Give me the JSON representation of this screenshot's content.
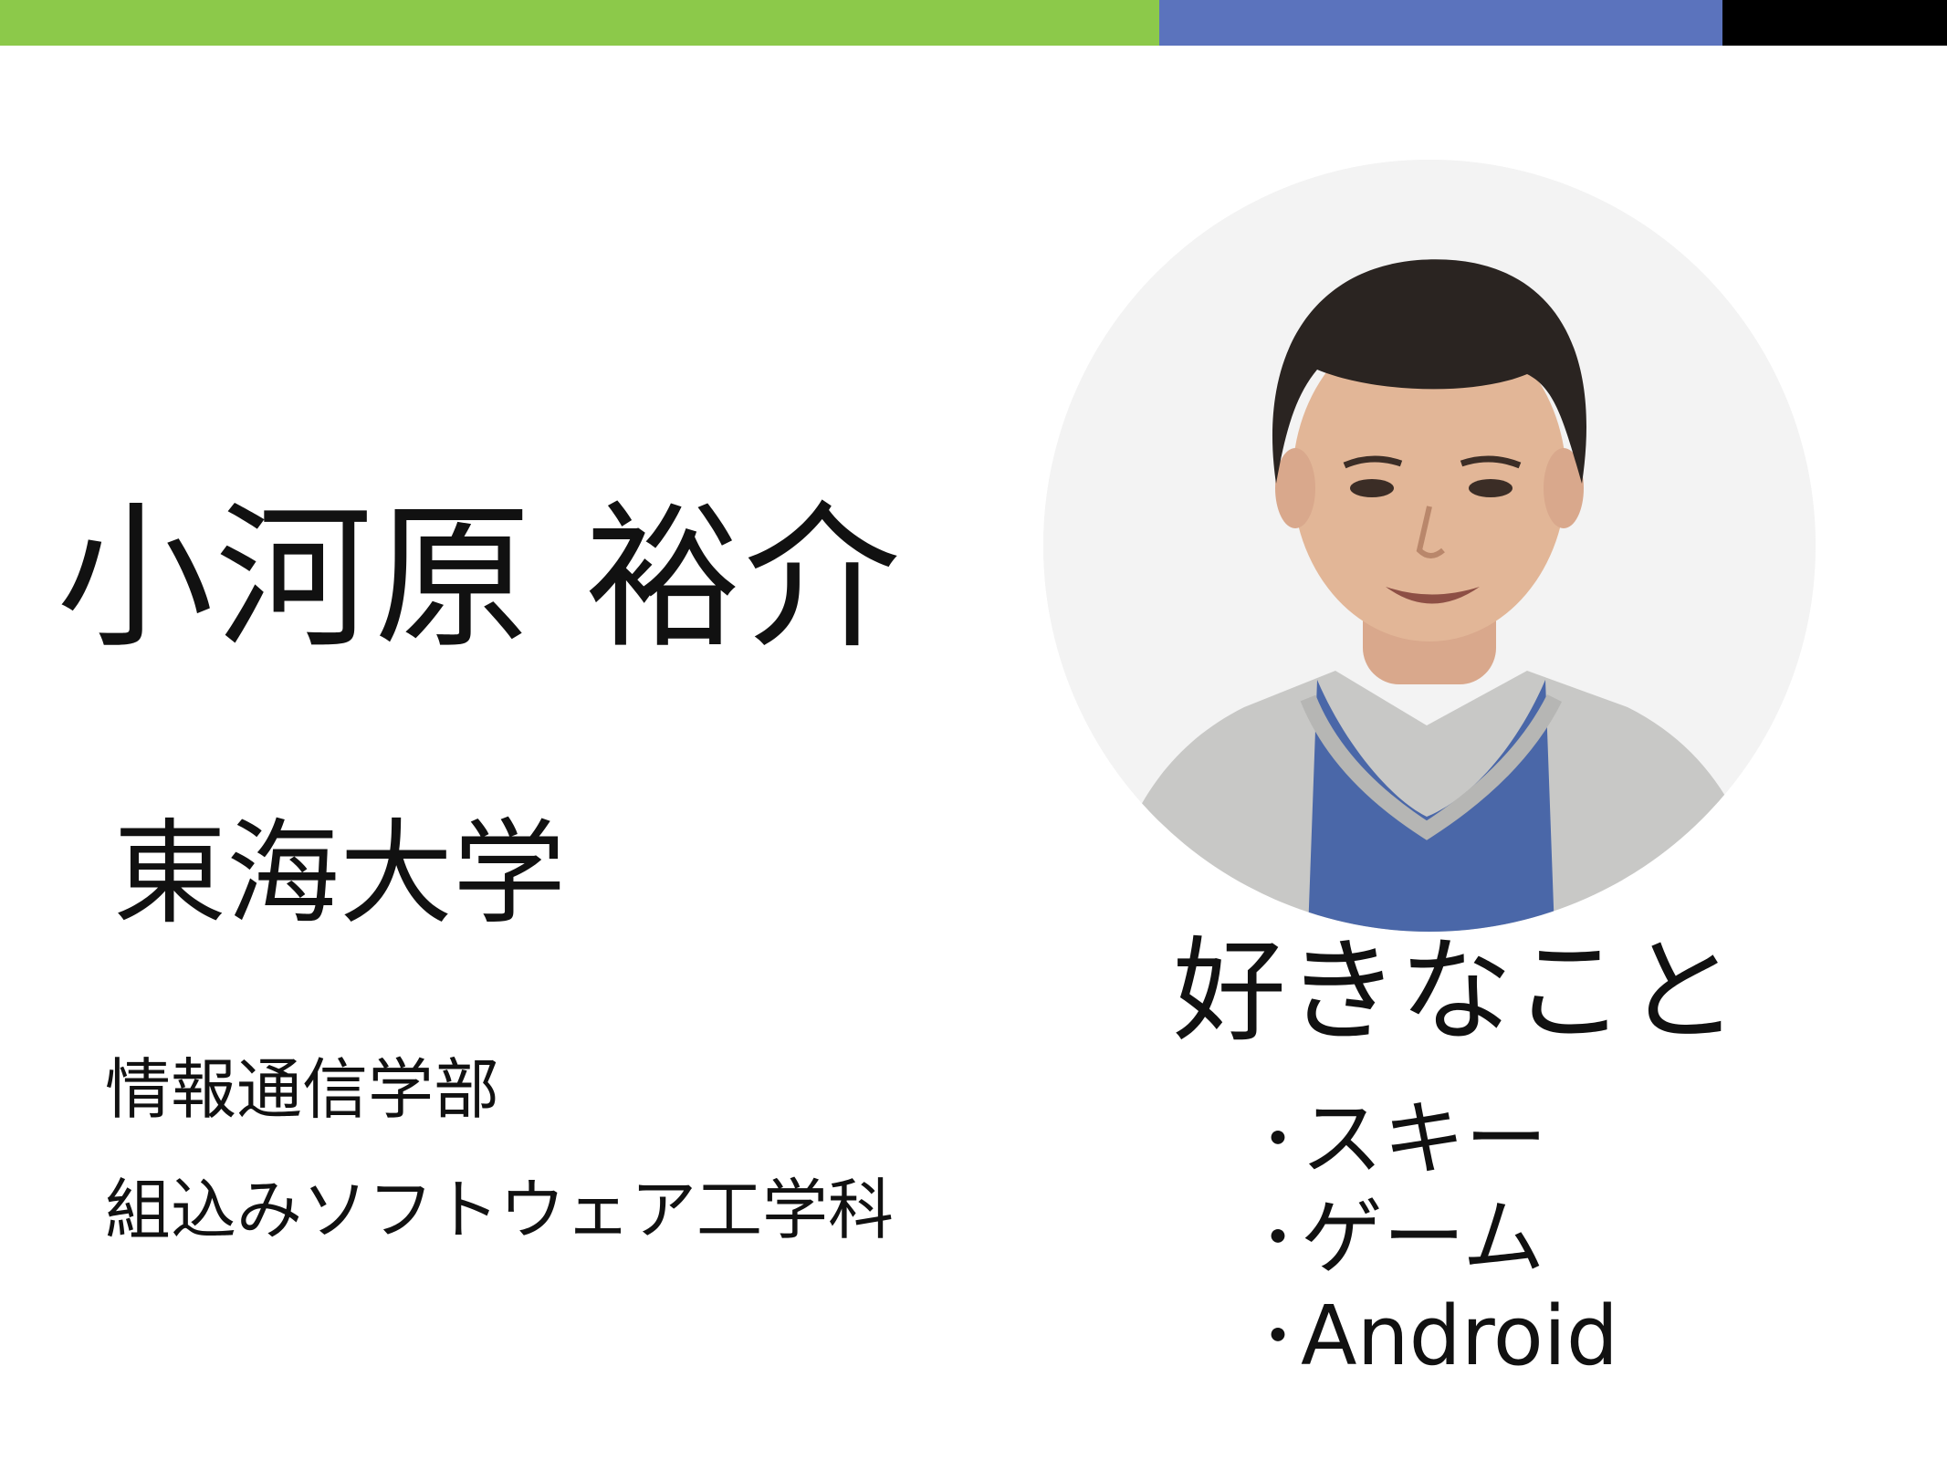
{
  "colors": {
    "bar_green": "#8cc94a",
    "bar_blue": "#5b73bd",
    "bar_black": "#000000"
  },
  "profile": {
    "name": "小河原 裕介",
    "university": "東海大学",
    "faculty": "情報通信学部",
    "department": "組込みソフトウェア工学科"
  },
  "likes": {
    "heading": "好きなこと",
    "bullet": "・",
    "items": [
      "スキー",
      "ゲーム",
      "Android"
    ]
  }
}
